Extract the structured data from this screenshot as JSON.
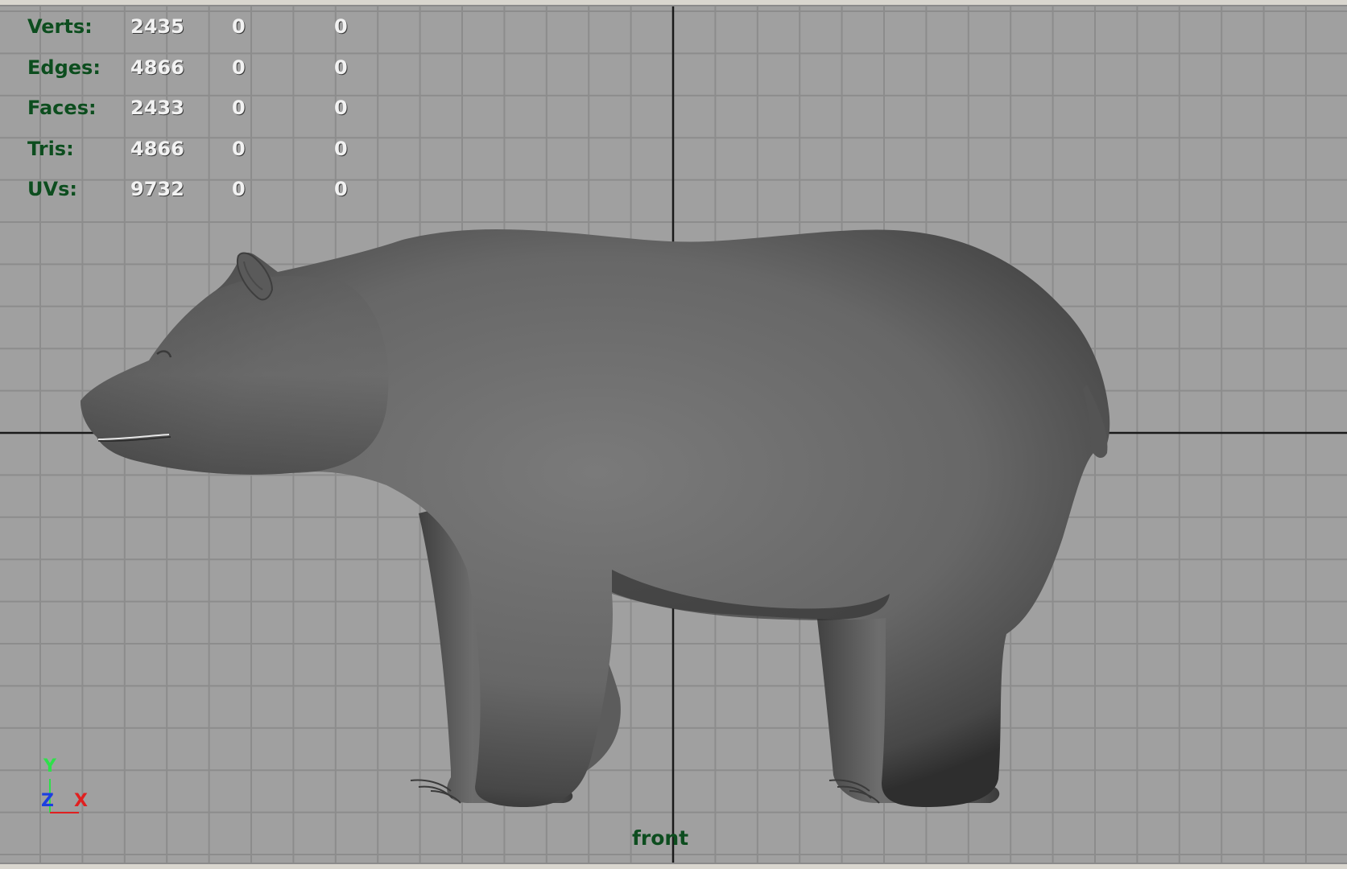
{
  "viewport": {
    "camera": "front",
    "background_color": "#a0a0a0",
    "grid_color": "#8c8c8c",
    "axis_line_color": "#1a1a1a",
    "model_color": "#6e6e6e"
  },
  "hud": {
    "label_color": "#0d4d1f",
    "value_color": "#f2f2f2",
    "rows": [
      {
        "label": "Verts:",
        "values": [
          "2435",
          "0",
          "0"
        ]
      },
      {
        "label": "Edges:",
        "values": [
          "4866",
          "0",
          "0"
        ]
      },
      {
        "label": "Faces:",
        "values": [
          "2433",
          "0",
          "0"
        ]
      },
      {
        "label": "Tris:",
        "values": [
          "4866",
          "0",
          "0"
        ]
      },
      {
        "label": "UVs:",
        "values": [
          "9732",
          "0",
          "0"
        ]
      }
    ]
  },
  "axis_gizmo": {
    "y": "Y",
    "z": "Z",
    "x": "X",
    "y_color": "#2ee04a",
    "z_color": "#1c3fe0",
    "x_color": "#e02020"
  }
}
